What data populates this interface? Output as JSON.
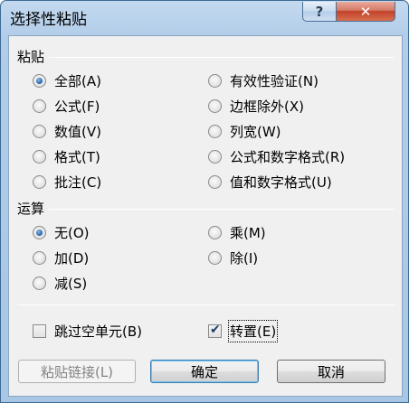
{
  "window": {
    "title": "选择性粘贴"
  },
  "titlebar": {
    "help_glyph": "?",
    "close_glyph": "✕"
  },
  "paste": {
    "group_label": "粘贴",
    "options": [
      {
        "label": "全部(A)",
        "selected": true
      },
      {
        "label": "公式(F)",
        "selected": false
      },
      {
        "label": "数值(V)",
        "selected": false
      },
      {
        "label": "格式(T)",
        "selected": false
      },
      {
        "label": "批注(C)",
        "selected": false
      },
      {
        "label": "有效性验证(N)",
        "selected": false
      },
      {
        "label": "边框除外(X)",
        "selected": false
      },
      {
        "label": "列宽(W)",
        "selected": false
      },
      {
        "label": "公式和数字格式(R)",
        "selected": false
      },
      {
        "label": "值和数字格式(U)",
        "selected": false
      }
    ]
  },
  "operation": {
    "group_label": "运算",
    "options": [
      {
        "label": "无(O)",
        "selected": true
      },
      {
        "label": "加(D)",
        "selected": false
      },
      {
        "label": "减(S)",
        "selected": false
      },
      {
        "label": "乘(M)",
        "selected": false
      },
      {
        "label": "除(I)",
        "selected": false
      }
    ]
  },
  "checkboxes": {
    "skip_blanks": {
      "label": "跳过空单元(B)",
      "checked": false
    },
    "transpose": {
      "label": "转置(E)",
      "checked": true
    }
  },
  "buttons": {
    "paste_link": "粘贴链接(L)",
    "ok": "确定",
    "cancel": "取消"
  }
}
